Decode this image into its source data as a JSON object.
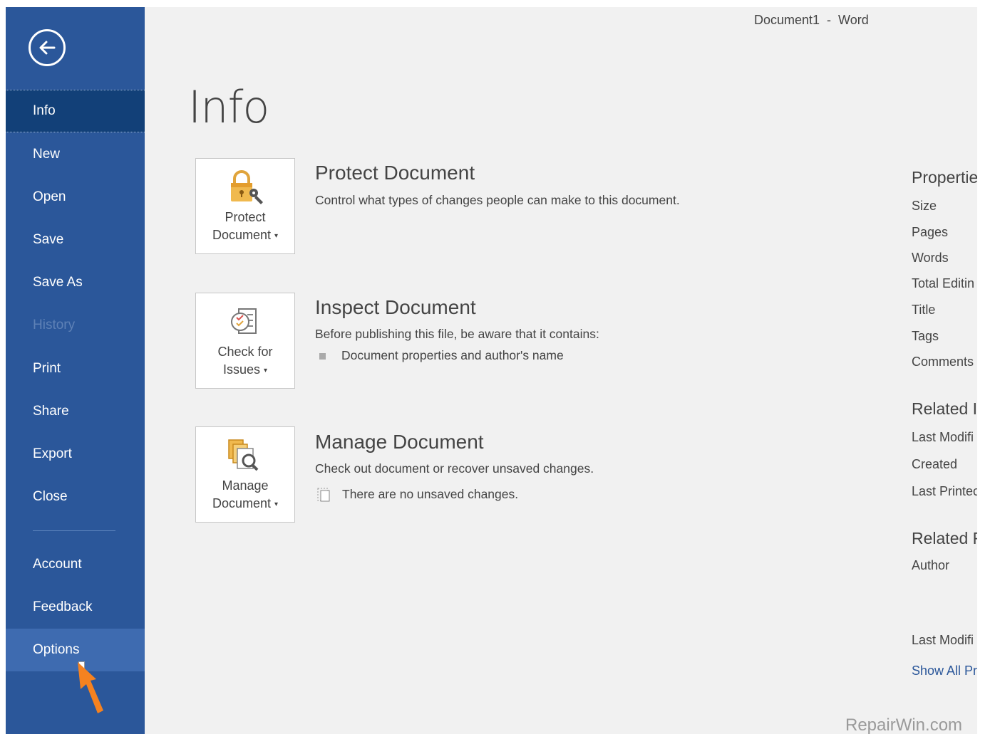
{
  "window": {
    "title": "Document1  -  Word"
  },
  "sidebar": {
    "items": [
      {
        "label": "Info"
      },
      {
        "label": "New"
      },
      {
        "label": "Open"
      },
      {
        "label": "Save"
      },
      {
        "label": "Save As"
      },
      {
        "label": "History"
      },
      {
        "label": "Print"
      },
      {
        "label": "Share"
      },
      {
        "label": "Export"
      },
      {
        "label": "Close"
      },
      {
        "label": "Account"
      },
      {
        "label": "Feedback"
      },
      {
        "label": "Options"
      }
    ]
  },
  "page": {
    "title": "Info"
  },
  "sections": {
    "protect": {
      "tile_line1": "Protect",
      "tile_line2": "Document",
      "title": "Protect Document",
      "description": "Control what types of changes people can make to this document."
    },
    "inspect": {
      "tile_line1": "Check for",
      "tile_line2": "Issues",
      "title": "Inspect Document",
      "description": "Before publishing this file, be aware that it contains:",
      "bullet": "Document properties and author's name"
    },
    "manage": {
      "tile_line1": "Manage",
      "tile_line2": "Document",
      "title": "Manage Document",
      "description": "Check out document or recover unsaved changes.",
      "status": "There are no unsaved changes."
    }
  },
  "properties": {
    "heading": "Propertie",
    "labels": [
      "Size",
      "Pages",
      "Words",
      "Total Editin",
      "Title",
      "Tags",
      "Comments"
    ],
    "related_dates_heading": "Related I",
    "date_labels": [
      "Last Modifi",
      "Created",
      "Last Printec"
    ],
    "related_people_heading": "Related F",
    "people_labels": [
      "Author"
    ],
    "last_modified_by": "Last Modifi",
    "show_all": "Show All Pr"
  },
  "watermark": "RepairWin.com",
  "colors": {
    "sidebar_bg": "#2b579a",
    "sidebar_active": "#124078",
    "sidebar_hover": "#3e6bb0",
    "content_bg": "#f1f1f1",
    "link": "#2b579a",
    "pointer_arrow": "#f58220"
  }
}
